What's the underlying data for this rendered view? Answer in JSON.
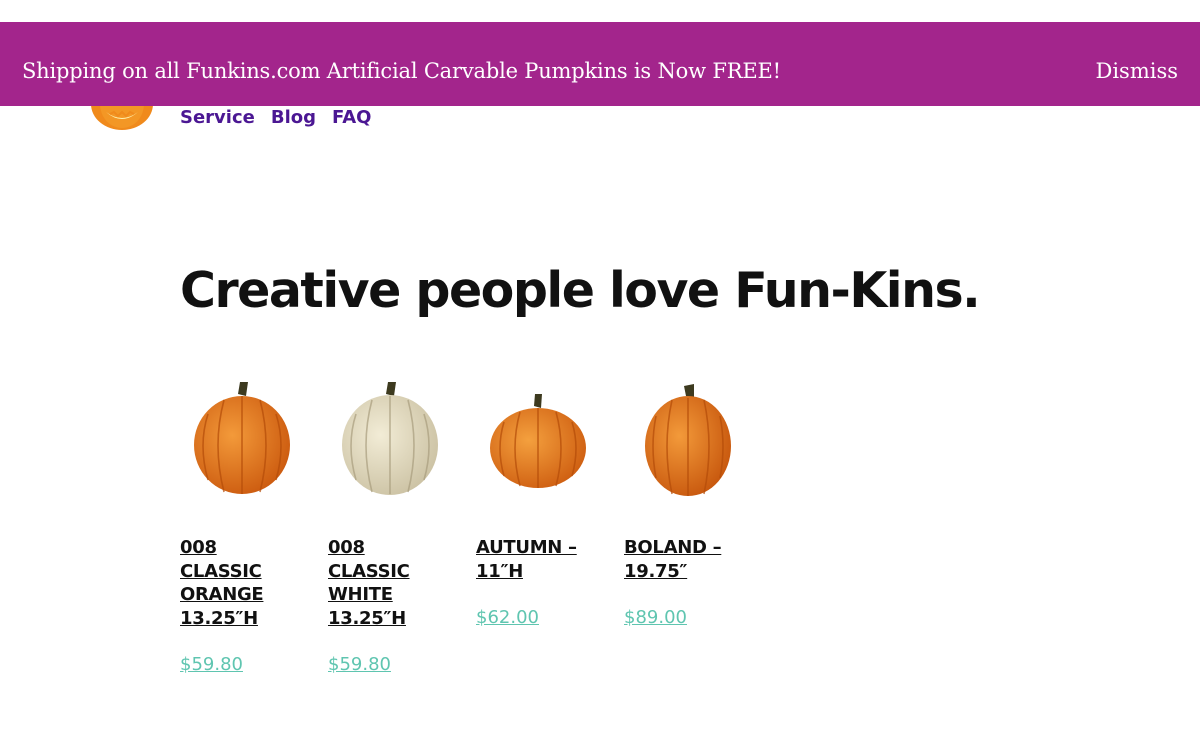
{
  "banner": {
    "message": "Shipping on all Funkins.com Artificial Carvable Pumpkins is Now FREE!",
    "dismiss_label": "Dismiss",
    "background_color": "#a3258c"
  },
  "logo": {
    "icon": "jack-o-lantern-icon"
  },
  "nav": {
    "items": [
      "Service",
      "Blog",
      "FAQ"
    ],
    "color": "#4b1793"
  },
  "main": {
    "headline": "Creative people love Fun-Kins."
  },
  "products": [
    {
      "title": "008 CLASSIC ORANGE 13.25″H",
      "price": "$59.80",
      "image": "orange-pumpkin"
    },
    {
      "title": "008 CLASSIC WHITE 13.25″H",
      "price": "$59.80",
      "image": "white-pumpkin"
    },
    {
      "title": "AUTUMN – 11″H",
      "price": "$62.00",
      "image": "orange-pumpkin-round"
    },
    {
      "title": "BOLAND – 19.75″",
      "price": "$89.00",
      "image": "orange-pumpkin-tall"
    }
  ],
  "colors": {
    "price": "#5fc5b0",
    "headline": "#111111"
  }
}
